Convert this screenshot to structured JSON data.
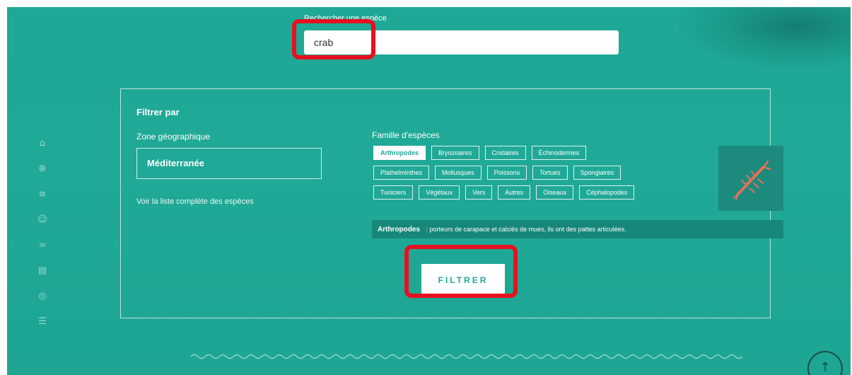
{
  "search": {
    "label": "Rechercher une espèce",
    "value": "crab"
  },
  "sidebar": {
    "icons": [
      "home-icon",
      "compass-icon",
      "list-icon",
      "user-icon",
      "binoculars-icon",
      "map-icon",
      "location-icon",
      "menu-icon"
    ]
  },
  "filter": {
    "title": "Filtrer par",
    "zone_label": "Zone géographique",
    "zone_value": "Méditerranée",
    "zone_link": "Voir la liste complète des espèces",
    "family_label": "Famille d'espèces",
    "chip_rows": [
      [
        "Arthropodes",
        "Bryozoaires",
        "Cnidaires",
        "Échinodermes"
      ],
      [
        "Plathelminthes",
        "Mollusques",
        "Poissons",
        "Tortues",
        "Spongiaires"
      ],
      [
        "Tuniciers",
        "Végétaux",
        "Vers",
        "Autres",
        "Oiseaux",
        "Céphalopodes"
      ]
    ],
    "active_chip": "Arthropodes",
    "description_name": "Arthropodes",
    "description_text": ": porteurs de carapace et calciés de mues, ils ont des pattes articulées.",
    "button_label": "FILTRER"
  },
  "colors": {
    "background": "#1fa895",
    "highlight": "#e8101f"
  }
}
